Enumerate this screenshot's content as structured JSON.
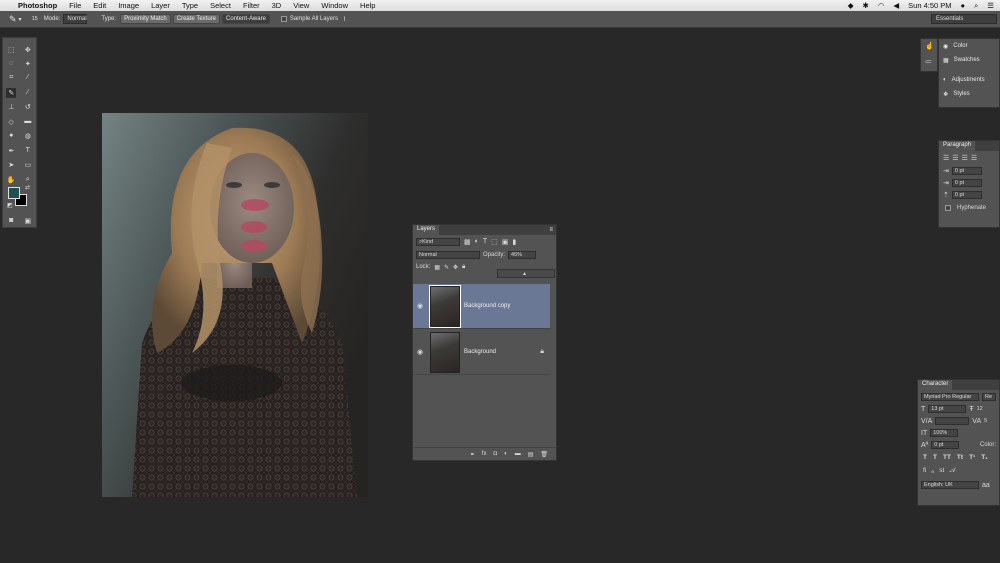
{
  "menubar": {
    "items": [
      "Photoshop",
      "File",
      "Edit",
      "Image",
      "Layer",
      "Type",
      "Select",
      "Filter",
      "3D",
      "View",
      "Window",
      "Help"
    ],
    "clock": "Sun 4:50 PM"
  },
  "options": {
    "brush_size": "15",
    "mode_label": "Mode:",
    "mode_value": "Normal",
    "type_label": "Type:",
    "type_buttons": [
      "Proximity Match",
      "Create Texture",
      "Content-Aware"
    ],
    "sample_all_layers": "Sample All Layers",
    "workspace": "Essentials"
  },
  "layers_panel": {
    "tab": "Layers",
    "filter": "Kind",
    "blend_mode": "Normal",
    "opacity_label": "Opacity:",
    "opacity_value": "45%",
    "lock_label": "Lock:",
    "layers": [
      {
        "name": "Background copy",
        "selected": true,
        "locked": false
      },
      {
        "name": "Background",
        "selected": false,
        "locked": true
      }
    ]
  },
  "right_top": {
    "items": [
      "Color",
      "Swatches",
      "Adjustments",
      "Styles"
    ]
  },
  "paragraph": {
    "tab": "Paragraph",
    "fields": [
      "0 pt",
      "0 pt",
      "0 pt"
    ],
    "hyphenate": "Hyphenate"
  },
  "character": {
    "tab": "Character",
    "font": "Myriad Pro Regular",
    "style_trunc": "Re",
    "size": "13 pt",
    "leading_trunc": "12",
    "tracking_trunc": "5",
    "scale": "100%",
    "baseline": "0 pt",
    "color_label": "Color:",
    "language": "English: UK"
  },
  "colors": {
    "foreground": "#1f4f52",
    "background": "#000000",
    "layer_selected": "#6a7896"
  }
}
